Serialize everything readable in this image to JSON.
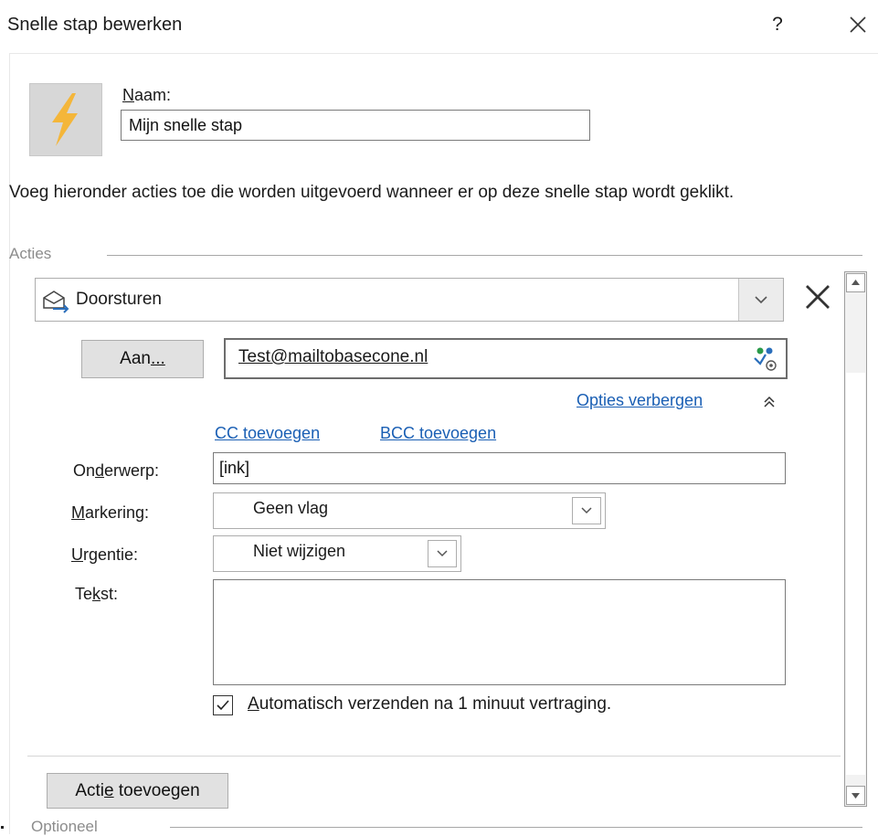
{
  "dialog": {
    "title": "Snelle stap bewerken",
    "help": "?"
  },
  "name": {
    "label_underlined": "N",
    "label_rest": "aam:",
    "value": "Mijn snelle stap"
  },
  "description": "Voeg hieronder acties toe die worden uitgevoerd wanneer er op deze snelle stap wordt geklikt.",
  "actions_group": {
    "label": "Acties",
    "action": "Doorsturen"
  },
  "forward": {
    "to_button_pre": "Aan",
    "to_button_underlined": "...",
    "to_value": "Test@mailtobasecone.nl",
    "hide_options": "Opties verbergen",
    "add_cc": "CC toevoegen",
    "add_bcc": "BCC toevoegen",
    "subject_label_pre": "On",
    "subject_label_underlined": "d",
    "subject_label_post": "erwerp:",
    "subject_value": "[ink]",
    "flag_label_underlined": "M",
    "flag_label_post": "arkering:",
    "flag_value": "Geen vlag",
    "importance_label_underlined": "U",
    "importance_label_post": "rgentie:",
    "importance_value": "Niet wijzigen",
    "text_label_pre": "Te",
    "text_label_underlined": "k",
    "text_label_post": "st:",
    "text_value": "",
    "autosend_checked": true,
    "autosend_underlined": "A",
    "autosend_post": "utomatisch verzenden na 1 minuut vertraging."
  },
  "add_action": {
    "pre": "Acti",
    "underlined": "e",
    "post": " toevoegen"
  },
  "optional_group": {
    "label": "Optioneel"
  },
  "colors": {
    "link": "#1a5fb4",
    "bolt": "#f4b63a",
    "accent_blue": "#2a6ebb"
  }
}
